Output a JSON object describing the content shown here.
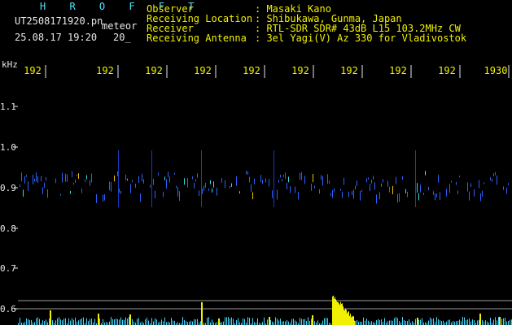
{
  "header": {
    "program": "H R O F F T",
    "filename": "UT2508171920.pn",
    "type": "meteor",
    "datetime": "25.08.17 19:20",
    "duration": "20_"
  },
  "info": [
    {
      "label": "Observer",
      "value": ": Masaki Kano"
    },
    {
      "label": "Receiving Location",
      "value": ": Shibukawa, Gunma, Japan"
    },
    {
      "label": "Receiver",
      "value": ": RTL-SDR SDR# 43dB L15 103.2MHz CW"
    },
    {
      "label": "Receiving Antenna",
      "value": ": 3el Yagi(V) Az 330 for Vladivostok"
    }
  ],
  "y_axis": {
    "unit": "kHz",
    "ticks": [
      "1.1",
      "1.0",
      "0.9",
      "0.8",
      "0.7",
      "0.6"
    ]
  },
  "x_axis": {
    "ticks": [
      "192",
      "192",
      "192",
      "192",
      "192",
      "192",
      "192",
      "192",
      "192",
      "1930"
    ]
  },
  "colors": {
    "background": "#000000",
    "label": "#f0f000",
    "program": "#4fe3ff",
    "trace": "#2a62ff",
    "meteor_core": "#ff2a6a",
    "bars": "#f0f000",
    "level": "#3fd8ff"
  }
}
